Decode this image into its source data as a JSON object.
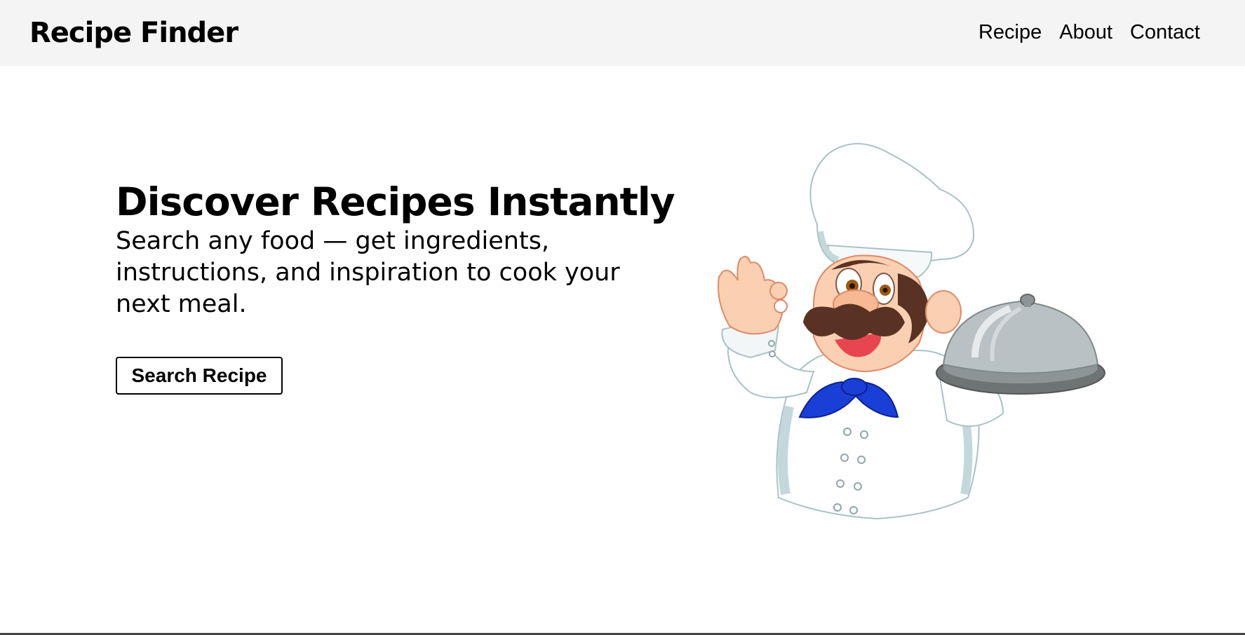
{
  "header": {
    "brand": "Recipe Finder",
    "nav": [
      {
        "label": "Recipe"
      },
      {
        "label": "About"
      },
      {
        "label": "Contact"
      }
    ]
  },
  "hero": {
    "title": "Discover Recipes Instantly",
    "subtitle": "Search any food — get ingredients, instructions, and inspiration to cook your next meal.",
    "button_label": "Search Recipe"
  },
  "illustration": {
    "icon": "chef-holding-cloche-illustration"
  },
  "colors": {
    "navbar_bg": "#f4f4f4",
    "page_bg": "#ffffff",
    "text": "#000000",
    "chef_scarf": "#1a3fd6",
    "chef_mustache": "#5a3223",
    "chef_skin": "#fbd0b2",
    "chef_clothes_shade": "#c3d8db",
    "cloche": "#b9c1c4"
  }
}
